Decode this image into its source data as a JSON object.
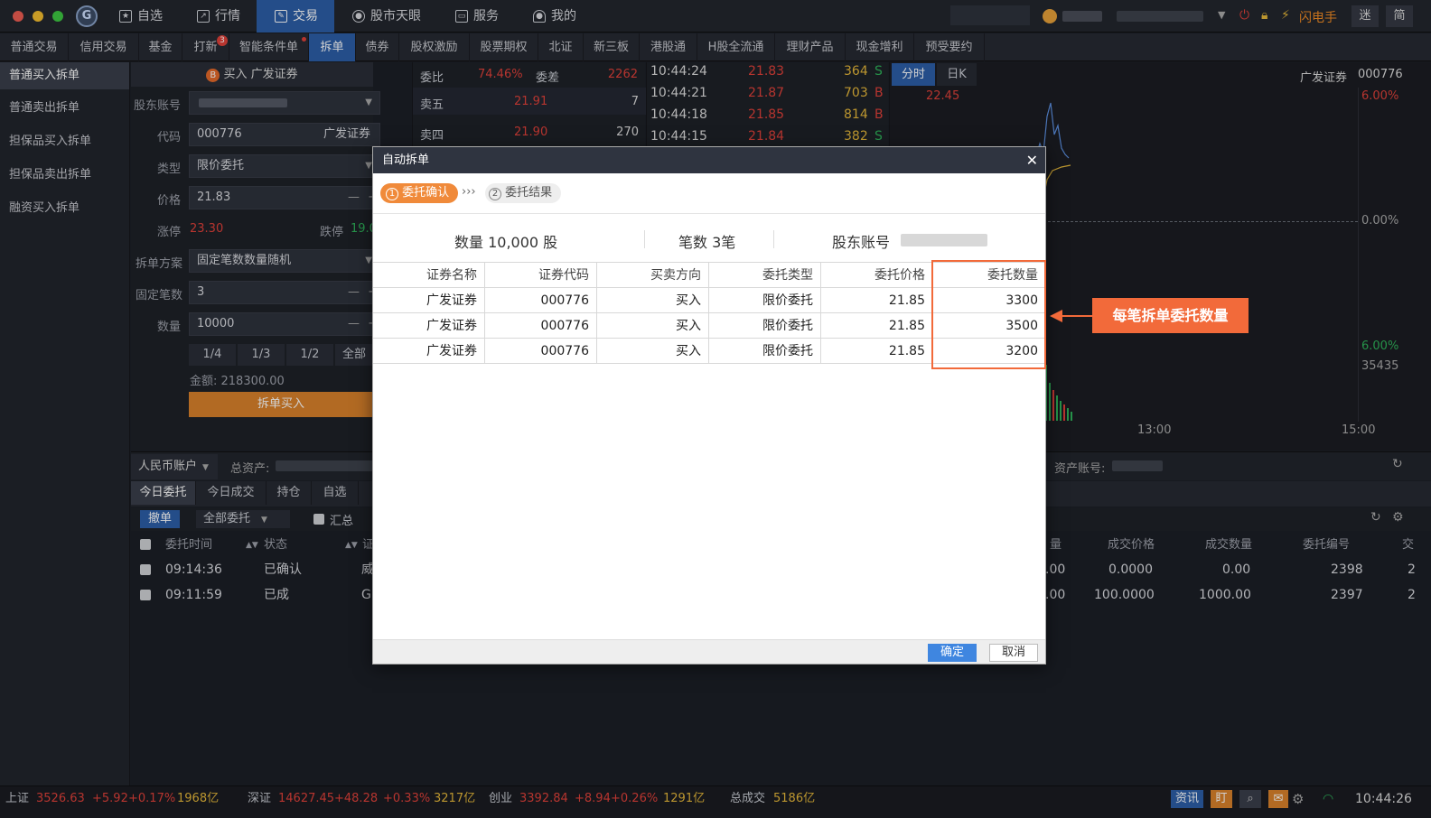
{
  "top_nav": {
    "items": [
      {
        "label": "自选",
        "icon": "star-icon"
      },
      {
        "label": "行情",
        "icon": "chart-icon"
      },
      {
        "label": "交易",
        "icon": "trade-icon"
      },
      {
        "label": "股市天眼",
        "icon": "eye-icon"
      },
      {
        "label": "服务",
        "icon": "briefcase-icon"
      },
      {
        "label": "我的",
        "icon": "user-icon"
      }
    ],
    "active": "交易",
    "flash_trader_label": "闪电手",
    "mini_label": "迷",
    "simple_label": "简"
  },
  "sub_nav": {
    "items": [
      "普通交易",
      "信用交易",
      "基金",
      "打新",
      "智能条件单",
      "拆单",
      "债券",
      "股权激励",
      "股票期权",
      "北证",
      "新三板",
      "港股通",
      "H股全流通",
      "理财产品",
      "现金增利",
      "预受要约"
    ],
    "active": "拆单",
    "ipo_badge": "3"
  },
  "sidebar": {
    "items": [
      "普通买入拆单",
      "普通卖出拆单",
      "担保品买入拆单",
      "担保品卖出拆单",
      "融资买入拆单"
    ],
    "active": "普通买入拆单"
  },
  "order_form": {
    "title_badge": "B",
    "title": "买入 广发证券",
    "account_label": "股东账号",
    "code_label": "代码",
    "code_value": "000776",
    "code_name": "广发证券",
    "type_label": "类型",
    "type_value": "限价委托",
    "price_label": "价格",
    "price_value": "21.83",
    "limit_up_label": "涨停",
    "limit_up_value": "23.30",
    "limit_down_label": "跌停",
    "limit_down_value": "19.0",
    "plan_label": "拆单方案",
    "plan_value": "固定笔数数量随机",
    "fixed_count_label": "固定笔数",
    "fixed_count_value": "3",
    "qty_label": "数量",
    "qty_value": "10000",
    "fractions": [
      "1/4",
      "1/3",
      "1/2",
      "全部"
    ],
    "amount_text": "金额: 218300.00",
    "submit_label": "拆单买入"
  },
  "order_book": {
    "ratio_label": "委比",
    "ratio_value": "74.46%",
    "diff_label": "委差",
    "diff_value": "2262",
    "rows": [
      {
        "label": "卖五",
        "price": "21.91",
        "vol": "7"
      },
      {
        "label": "卖四",
        "price": "21.90",
        "vol": "270"
      }
    ]
  },
  "ticks": [
    {
      "time": "10:44:24",
      "price": "21.83",
      "vol": "364",
      "side": "S"
    },
    {
      "time": "10:44:21",
      "price": "21.87",
      "vol": "703",
      "side": "B"
    },
    {
      "time": "10:44:18",
      "price": "21.85",
      "vol": "814",
      "side": "B"
    },
    {
      "time": "10:44:15",
      "price": "21.84",
      "vol": "382",
      "side": "S"
    }
  ],
  "chart_panel": {
    "tab_intraday": "分时",
    "tab_daily": "日K",
    "stock_name": "广发证券",
    "stock_code": "000776",
    "top_price": "22.45",
    "pct_top": "6.00%",
    "pct_mid": "0.00%",
    "pct_low": "6.00%",
    "volume_label": "35435",
    "time_1300": "13:00",
    "time_1500": "15:00"
  },
  "account_bar": {
    "currency_label": "人民币账户",
    "total_assets_label": "总资产:",
    "asset_account_label": "资产账号:"
  },
  "bottom_tabs": [
    "今日委托",
    "今日成交",
    "持仓",
    "自选"
  ],
  "bottom_toolbar": {
    "cancel_label": "撤单",
    "filter_value": "全部委托",
    "summary_label": "汇总"
  },
  "orders_table": {
    "headers_left": [
      "委托时间",
      "状态",
      "证"
    ],
    "headers_right": [
      "量",
      "成交价格",
      "成交数量",
      "委托编号",
      "交"
    ],
    "rows": [
      {
        "time": "09:14:36",
        "status": "已确认",
        "sec": "威",
        "qty": ".00",
        "deal_price": "0.0000",
        "deal_qty": "0.00",
        "order_no": "2398",
        "extra": "2"
      },
      {
        "time": "09:11:59",
        "status": "已成",
        "sec": "G",
        "qty": ".00",
        "deal_price": "100.0000",
        "deal_qty": "1000.00",
        "order_no": "2397",
        "extra": "2"
      }
    ]
  },
  "modal": {
    "title": "自动拆单",
    "step1_num": "1",
    "step1_label": "委托确认",
    "step_arrows": "›››",
    "step2_num": "2",
    "step2_label": "委托结果",
    "summary_qty": "数量 10,000 股",
    "summary_count": "笔数 3笔",
    "summary_account_label": "股东账号",
    "headers": [
      "证券名称",
      "证券代码",
      "买卖方向",
      "委托类型",
      "委托价格",
      "委托数量"
    ],
    "rows": [
      [
        "广发证券",
        "000776",
        "买入",
        "限价委托",
        "21.85",
        "3300"
      ],
      [
        "广发证券",
        "000776",
        "买入",
        "限价委托",
        "21.85",
        "3500"
      ],
      [
        "广发证券",
        "000776",
        "买入",
        "限价委托",
        "21.85",
        "3200"
      ]
    ],
    "confirm_label": "确定",
    "cancel_label": "取消"
  },
  "annotation": {
    "text": "每笔拆单委托数量"
  },
  "status_bar": {
    "sh": {
      "name": "上证",
      "value": "3526.63",
      "chg": "+5.92",
      "pct": "+0.17%",
      "amt": "1968亿"
    },
    "sz": {
      "name": "深证",
      "value": "14627.45",
      "chg": "+48.28",
      "pct": "+0.33%",
      "amt": "3217亿"
    },
    "cy": {
      "name": "创业",
      "value": "3392.84",
      "chg": "+8.94",
      "pct": "+0.26%",
      "amt": "1291亿"
    },
    "total_label": "总成交",
    "total_value": "5186亿",
    "news_label": "资讯",
    "ding_label": "盯",
    "clock": "10:44:26"
  },
  "colors": {
    "accent_blue": "#2d5fa8",
    "up_red": "#e0413a",
    "down_green": "#2fb35a",
    "annotation_orange": "#f26a3a"
  }
}
